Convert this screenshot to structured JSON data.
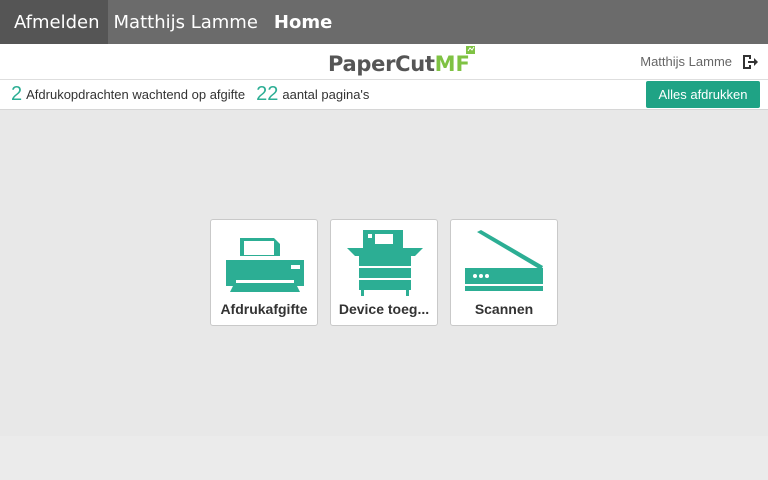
{
  "topbar": {
    "logout_label": "Afmelden",
    "user_name": "Matthijs Lamme",
    "home_label": "Home"
  },
  "brand": {
    "logo_paper": "PaperCut",
    "logo_mf": "MF",
    "user_name": "Matthijs Lamme",
    "exit_icon": "exit-icon"
  },
  "status": {
    "jobs_count": "2",
    "jobs_text": "Afdrukopdrachten wachtend op afgifte",
    "pages_count": "22",
    "pages_text": "aantal pagina's",
    "print_all_label": "Alles afdrukken"
  },
  "tiles": [
    {
      "label": "Afdrukafgifte",
      "icon": "printer-icon"
    },
    {
      "label": "Device toeg...",
      "icon": "copier-icon"
    },
    {
      "label": "Scannen",
      "icon": "scanner-icon"
    }
  ],
  "colors": {
    "accent": "#2cae94",
    "button": "#1fa385",
    "topbar": "#6b6b6b",
    "logo_green": "#7fc243"
  }
}
